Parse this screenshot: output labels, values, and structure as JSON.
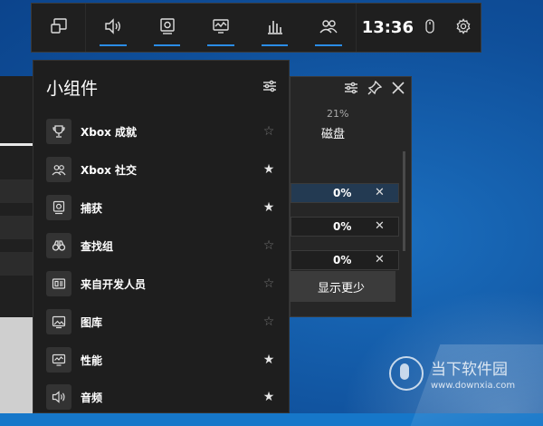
{
  "topbar": {
    "time": "13:36",
    "buttons": [
      {
        "name": "widget-menu",
        "icon": "widget-menu-icon",
        "active": false
      },
      {
        "name": "audio",
        "icon": "speaker-icon",
        "active": true
      },
      {
        "name": "capture",
        "icon": "capture-icon",
        "active": true
      },
      {
        "name": "performance",
        "icon": "monitor-chart-icon",
        "active": true
      },
      {
        "name": "resources",
        "icon": "bar-chart-icon",
        "active": true
      },
      {
        "name": "xbox-social",
        "icon": "people-icon",
        "active": true
      }
    ]
  },
  "widgets": {
    "title": "小组件",
    "items": [
      {
        "label": "Xbox 成就",
        "icon": "trophy-icon",
        "favorite": false
      },
      {
        "label": "Xbox 社交",
        "icon": "people-icon",
        "favorite": true
      },
      {
        "label": "捕获",
        "icon": "capture-icon",
        "favorite": true
      },
      {
        "label": "查找组",
        "icon": "binoculars-icon",
        "favorite": false
      },
      {
        "label": "来自开发人员",
        "icon": "developer-icon",
        "favorite": false
      },
      {
        "label": "图库",
        "icon": "gallery-icon",
        "favorite": false
      },
      {
        "label": "性能",
        "icon": "monitor-chart-icon",
        "favorite": true
      },
      {
        "label": "音频",
        "icon": "speaker-icon",
        "favorite": true
      }
    ]
  },
  "resources": {
    "disk_percent": "21%",
    "disk_label": "磁盘",
    "rows": [
      "0%",
      "0%",
      "0%"
    ],
    "show_more": "显示更少"
  },
  "watermark": {
    "name": "当下软件园",
    "url": "www.downxia.com"
  }
}
